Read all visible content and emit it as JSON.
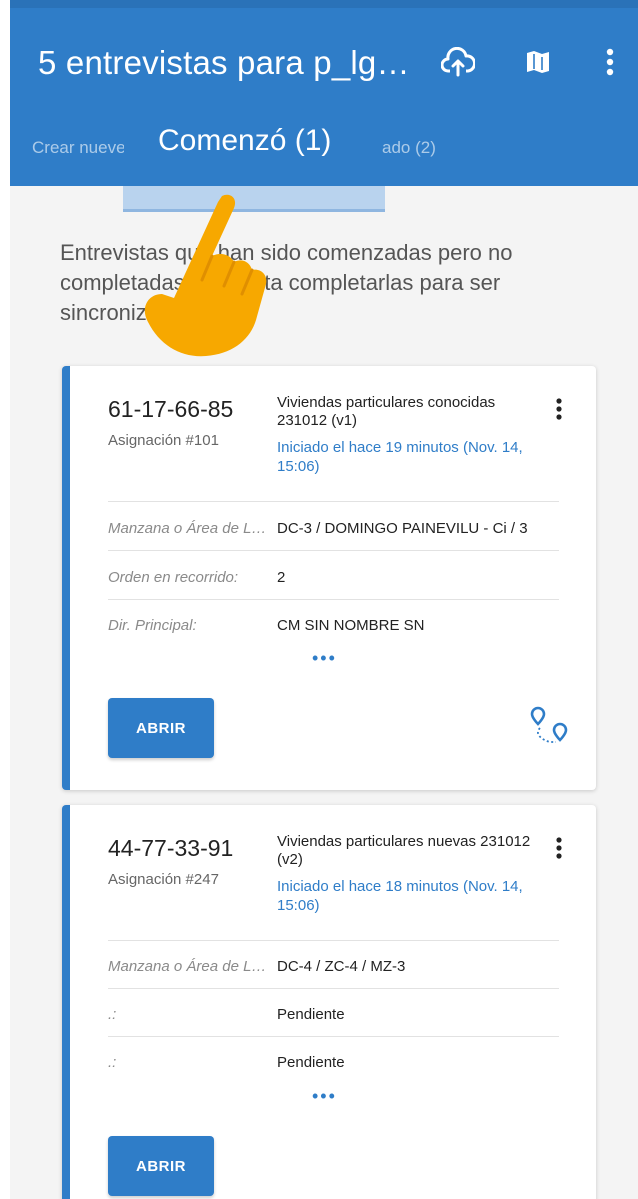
{
  "appbar": {
    "title": "5 entrevistas para p_lg…",
    "icons": [
      "cloud-upload-icon",
      "map-icon",
      "more-vert-icon"
    ]
  },
  "tabs": [
    {
      "label": "Crear nueve",
      "active": false
    },
    {
      "label": "Comenzó (1)",
      "active": true
    },
    {
      "label": "ado (2)",
      "active": false
    }
  ],
  "intro_text": "Entrevistas que han sido comenzadas pero no completadas. Necesita completarlas para ser sincronizadas.",
  "cards": [
    {
      "code": "61-17-66-85",
      "assignment": "Asignación #101",
      "survey": "Viviendas particulares conocidas 231012 (v1)",
      "started": "Iniciado el hace 19 minutos (Nov. 14, 15:06)",
      "rows": [
        {
          "label": "Manzana o Área de L…",
          "value": "DC-3 / DOMINGO PAINEVILU - Ci / 3"
        },
        {
          "label": "Orden en recorrido:",
          "value": "2"
        },
        {
          "label": "Dir. Principal:",
          "value": "CM SIN NOMBRE SN"
        }
      ],
      "more": "•••",
      "open_label": "ABRIR"
    },
    {
      "code": "44-77-33-91",
      "assignment": "Asignación #247",
      "survey": "Viviendas particulares nuevas 231012 (v2)",
      "started": "Iniciado el hace 18 minutos (Nov. 14, 15:06)",
      "rows": [
        {
          "label": "Manzana o Área de L…",
          "value": "DC-4 / ZC-4 / MZ-3"
        },
        {
          "label": ".:",
          "value": "Pendiente"
        },
        {
          "label": ".:",
          "value": "Pendiente"
        }
      ],
      "more": "•••",
      "open_label": "ABRIR"
    }
  ],
  "colors": {
    "primary": "#2f7dc8",
    "tab_indicator": "#b9d3ee",
    "hand_overlay": "#f7a800"
  }
}
